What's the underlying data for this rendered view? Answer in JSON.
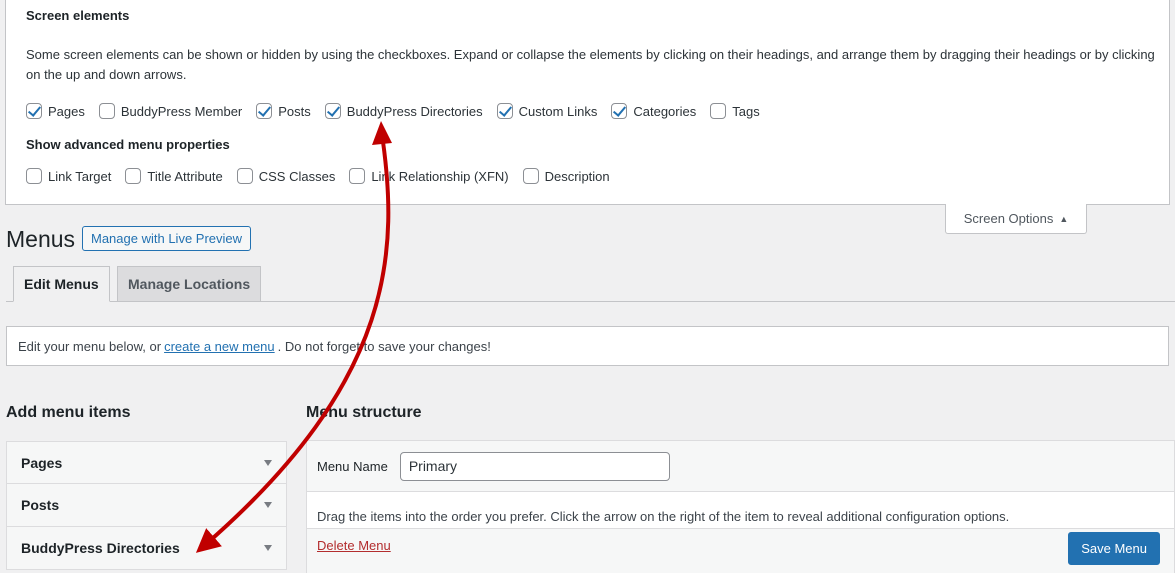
{
  "screen_options": {
    "title": "Screen elements",
    "description": "Some screen elements can be shown or hidden by using the checkboxes. Expand or collapse the elements by clicking on their headings, and arrange them by dragging their headings or by clicking on the up and down arrows.",
    "elements": [
      {
        "label": "Pages",
        "checked": true
      },
      {
        "label": "BuddyPress Member",
        "checked": false
      },
      {
        "label": "Posts",
        "checked": true
      },
      {
        "label": "BuddyPress Directories",
        "checked": true
      },
      {
        "label": "Custom Links",
        "checked": true
      },
      {
        "label": "Categories",
        "checked": true
      },
      {
        "label": "Tags",
        "checked": false
      }
    ],
    "advanced_title": "Show advanced menu properties",
    "advanced": [
      {
        "label": "Link Target",
        "checked": false
      },
      {
        "label": "Title Attribute",
        "checked": false
      },
      {
        "label": "CSS Classes",
        "checked": false
      },
      {
        "label": "Link Relationship (XFN)",
        "checked": false
      },
      {
        "label": "Description",
        "checked": false
      }
    ],
    "toggle_label": "Screen Options"
  },
  "header": {
    "title": "Menus",
    "live_preview": "Manage with Live Preview"
  },
  "tabs": [
    {
      "label": "Edit Menus"
    },
    {
      "label": "Manage Locations"
    }
  ],
  "notice": {
    "before": "Edit your menu below, or",
    "link": "create a new menu",
    "after": ". Do not forget to save your changes!"
  },
  "add_items": {
    "title": "Add menu items",
    "items": [
      {
        "label": "Pages"
      },
      {
        "label": "Posts"
      },
      {
        "label": "BuddyPress Directories"
      }
    ]
  },
  "structure": {
    "title": "Menu structure",
    "name_label": "Menu Name",
    "name_value": "Primary",
    "drag_text": "Drag the items into the order you prefer. Click the arrow on the right of the item to reveal additional configuration options.",
    "delete_label": "Delete Menu",
    "save_label": "Save Menu"
  },
  "colors": {
    "accent": "#2271b1",
    "annotation_arrow": "#c00000",
    "delete": "#b32d2e"
  }
}
